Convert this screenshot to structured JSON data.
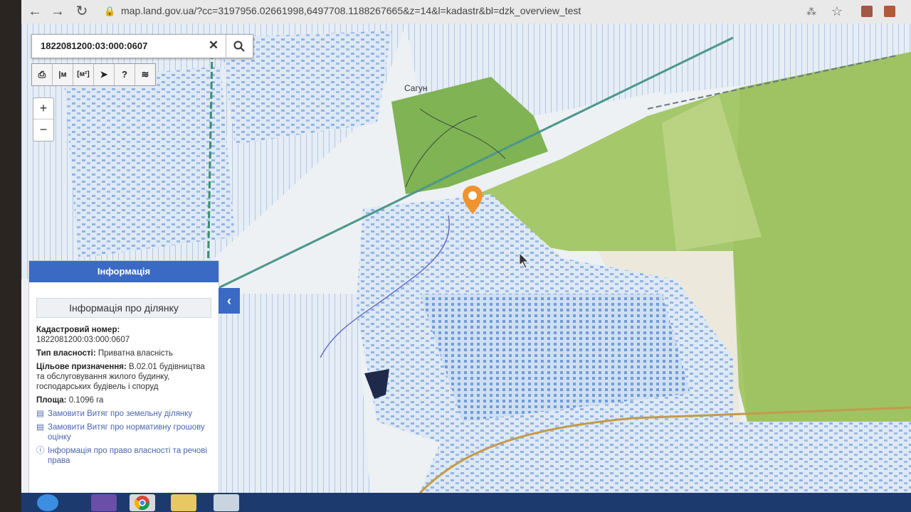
{
  "browser": {
    "url": "map.land.gov.ua/?cc=3197956.02661998,6497708.1188267665&z=14&l=kadastr&bl=dzk_overview_test",
    "back_icon": "←",
    "forward_icon": "→",
    "reload_icon": "↻",
    "lock_icon": "🔒",
    "translate_icon": "⁂",
    "star_icon": "☆"
  },
  "search": {
    "value": "1822081200:03:000:0607",
    "clear_icon": "✕",
    "search_icon": "⌕"
  },
  "toolbar": {
    "tools": [
      {
        "name": "print-icon",
        "glyph": "⎙"
      },
      {
        "name": "measure-distance-icon",
        "glyph": "|м"
      },
      {
        "name": "measure-area-icon",
        "glyph": "[м²]"
      },
      {
        "name": "pointer-icon",
        "glyph": "➤"
      },
      {
        "name": "help-icon",
        "glyph": "?"
      },
      {
        "name": "layers-icon",
        "glyph": "≋"
      }
    ]
  },
  "zoom": {
    "in": "+",
    "out": "−"
  },
  "map": {
    "label": "Сагун"
  },
  "info_panel": {
    "header": "Інформація",
    "subtitle": "Інформація про ділянку",
    "cadastral_label": "Кадастровий номер:",
    "cadastral_value": "1822081200:03:000:0607",
    "ownership_label": "Тип власності:",
    "ownership_value": "Приватна власність",
    "purpose_label": "Цільове призначення:",
    "purpose_value": "В.02.01 будівництва та обслуговування жилого будинку, господарських будівель і споруд",
    "area_label": "Площа:",
    "area_value": "0.1096 га",
    "links": [
      "Замовити Витяг про земельну ділянку",
      "Замовити Витяг про нормативну грошову оцінку",
      "Інформація про право власності та речові права"
    ],
    "collapse_icon": "‹"
  },
  "colors": {
    "accent": "#3b6ac4",
    "forest": "#7fb354",
    "parcel_blue": "#7aa6e0",
    "marker": "#f0922e"
  }
}
